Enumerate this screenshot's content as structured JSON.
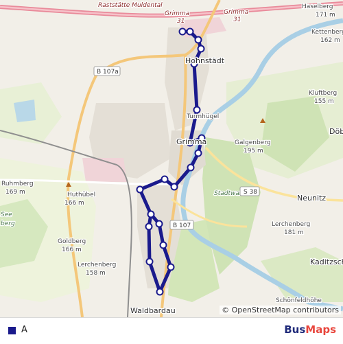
{
  "map": {
    "labels": {
      "raststaette": "Raststätte Muldental",
      "grimma_exit_left": "Grimma",
      "grimma_exit_left_num": "31",
      "grimma_exit_right": "Grimma",
      "grimma_exit_right_num": "31",
      "haselberg": "Haselberg",
      "haselberg_elev": "171 m",
      "kettenberg": "Kettenberg",
      "kettenberg_elev": "162 m",
      "hohnstaedt": "Hohnstädt",
      "b107a": "B 107a",
      "kluftberg": "Kluftberg",
      "kluftberg_elev": "155 m",
      "doeb": "Döb",
      "turmhuegel": "Turmhügel",
      "grimma": "Grimma",
      "galgenberg": "Galgenberg",
      "galgenberg_elev": "195 m",
      "ruhmberg": "Ruhmberg",
      "ruhmberg_elev": "169 m",
      "huthuebel": "Huthübel",
      "huthuebel_elev": "166 m",
      "stadtwald": "Stadtwald",
      "s38": "S 38",
      "neunitz": "Neunitz",
      "see": "See",
      "see_berg": "berg",
      "b107": "B 107",
      "lerchenberg_ne": "Lerchenberg",
      "lerchenberg_ne_elev": "181 m",
      "goldberg": "Goldberg",
      "goldberg_elev": "166 m",
      "lerchenberg_sw": "Lerchenberg",
      "lerchenberg_sw_elev": "158 m",
      "kaditzsch": "Kaditzsch",
      "schoenfeldhoehe": "Schönfeldhöhe",
      "waldbardau": "Waldbardau"
    },
    "attribution": "© OpenStreetMap contributors",
    "route_color": "#1a1a8c"
  },
  "legend": {
    "route_label": "A",
    "route_color": "#1a1a8c"
  },
  "brand": {
    "part1": "Bus",
    "part2": "Maps"
  }
}
